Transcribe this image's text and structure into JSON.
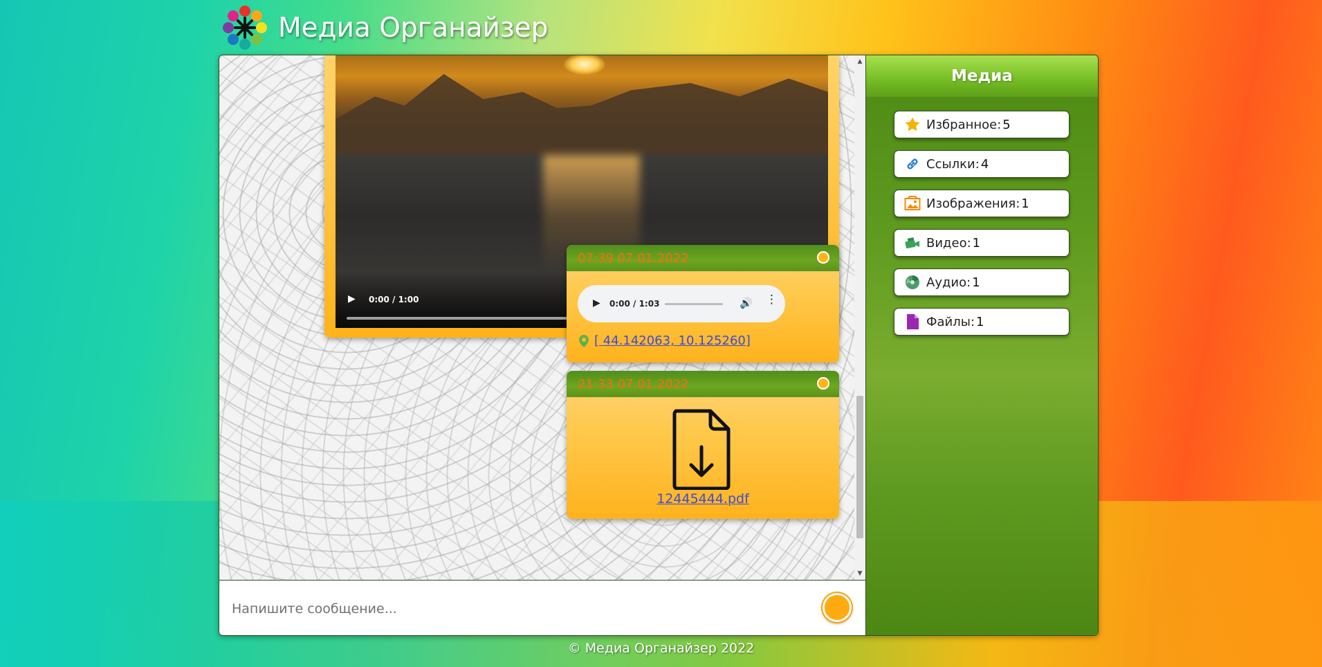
{
  "app": {
    "title": "Медиа Органайзер",
    "footer": "© Медиа Органайзер 2022"
  },
  "feed": {
    "video": {
      "time": "0:00 / 1:00"
    },
    "messages": [
      {
        "timestamp": "07:39 07.01.2022",
        "audio_time": "0:00 / 1:03",
        "geo": "[ 44.142063, 10.125260]"
      },
      {
        "timestamp": "21:33 07.01.2022",
        "file_name": "12445444.pdf"
      }
    ]
  },
  "composer": {
    "placeholder": "Напишите сообщение..."
  },
  "sidebar": {
    "title": "Медиа",
    "items": [
      {
        "label": "Избранное:",
        "count": "5",
        "icon": "star-icon"
      },
      {
        "label": "Ссылки:",
        "count": "4",
        "icon": "link-icon"
      },
      {
        "label": "Изображения:",
        "count": "1",
        "icon": "image-icon"
      },
      {
        "label": "Видео:",
        "count": "1",
        "icon": "video-icon"
      },
      {
        "label": "Аудио:",
        "count": "1",
        "icon": "audio-icon"
      },
      {
        "label": "Файлы:",
        "count": "1",
        "icon": "file-icon"
      }
    ]
  },
  "colors": {
    "accent_orange": "#ffb21c",
    "header_green": "#5e9a1e",
    "timestamp_orange": "#ff6a10",
    "link_blue": "#3b4bd8"
  }
}
